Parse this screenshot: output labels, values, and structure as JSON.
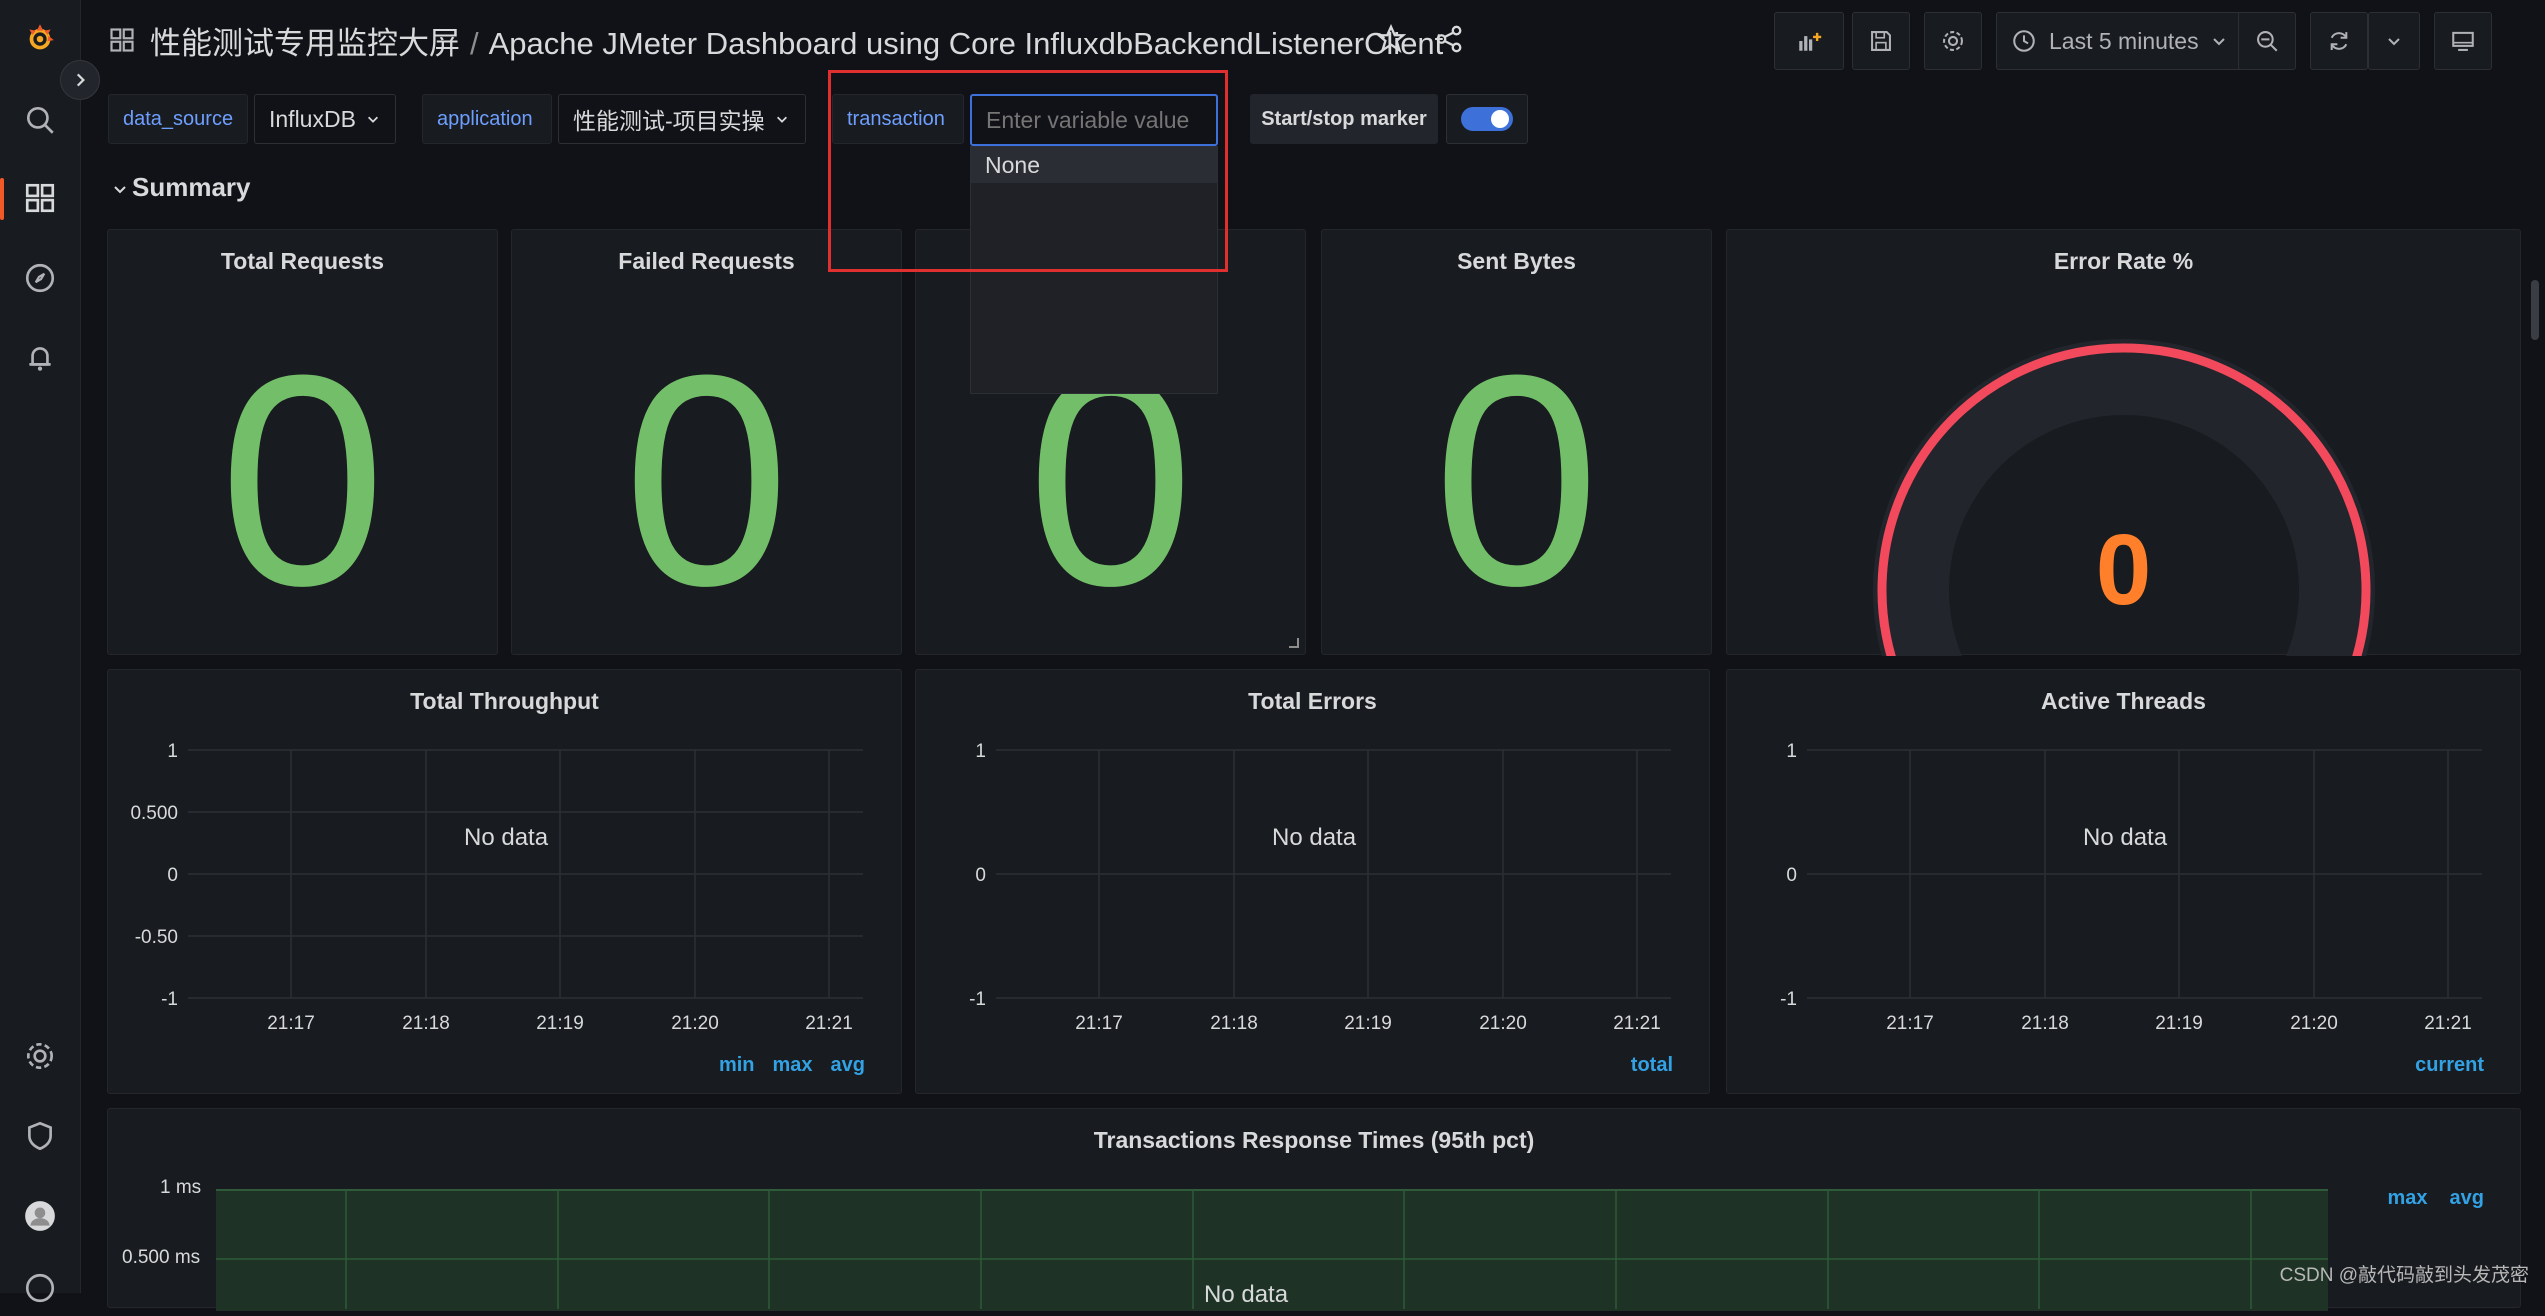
{
  "header": {
    "folder": "性能测试专用监控大屏",
    "separator": "/",
    "dashboard": "Apache JMeter Dashboard using Core InfluxdbBackendListenerClient",
    "time_range": "Last 5 minutes"
  },
  "variables": {
    "data_source": {
      "label": "data_source",
      "value": "InfluxDB"
    },
    "application": {
      "label": "application",
      "value": "性能测试-项目实操"
    },
    "transaction": {
      "label": "transaction",
      "placeholder": "Enter variable value",
      "options": [
        "None"
      ]
    },
    "marker": {
      "label": "Start/stop marker",
      "enabled": true
    }
  },
  "row": {
    "title": "Summary"
  },
  "stats": [
    {
      "title": "Total Requests",
      "value": "0"
    },
    {
      "title": "Failed Requests",
      "value": "0"
    },
    {
      "title": "",
      "value": "0"
    },
    {
      "title": "Sent Bytes",
      "value": "0"
    }
  ],
  "gauge": {
    "title": "Error Rate %",
    "value": "0",
    "color": "#f2495c"
  },
  "timeseries": [
    {
      "title": "Total Throughput",
      "no_data": "No data",
      "y_ticks": [
        "1",
        "0.500",
        "0",
        "-0.50",
        "-1"
      ],
      "x_ticks": [
        "21:17",
        "21:18",
        "21:19",
        "21:20",
        "21:21"
      ],
      "legend": [
        "min",
        "max",
        "avg"
      ]
    },
    {
      "title": "Total Errors",
      "no_data": "No data",
      "y_ticks": [
        "1",
        "0",
        "-1"
      ],
      "x_ticks": [
        "21:17",
        "21:18",
        "21:19",
        "21:20",
        "21:21"
      ],
      "legend": [
        "total"
      ]
    },
    {
      "title": "Active Threads",
      "no_data": "No data",
      "y_ticks": [
        "1",
        "0",
        "-1"
      ],
      "x_ticks": [
        "21:17",
        "21:18",
        "21:19",
        "21:20",
        "21:21"
      ],
      "legend": [
        "current"
      ]
    }
  ],
  "response_times": {
    "title": "Transactions Response Times (95th pct)",
    "y_ticks": [
      "1 ms",
      "0.500 ms"
    ],
    "legend": [
      "max",
      "avg"
    ],
    "no_data": "No data"
  },
  "watermark": "CSDN @敲代码敲到头发茂密",
  "colors": {
    "stat_green": "#73bf69",
    "accent_blue": "#3d71d9",
    "highlight_red": "#e02f2f",
    "gauge_value": "#ff7f2a"
  }
}
